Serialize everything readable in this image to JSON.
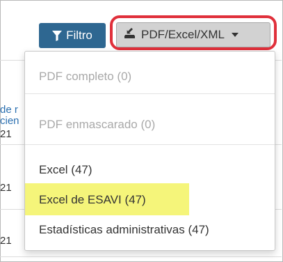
{
  "toolbar": {
    "filter_label": "Filtro",
    "export_label": "PDF/Excel/XML"
  },
  "export_menu": {
    "items": [
      {
        "label": "PDF completo (0)",
        "enabled": false
      },
      {
        "label": "PDF enmascarado (0)",
        "enabled": false
      },
      {
        "label": "Excel (47)",
        "enabled": true
      },
      {
        "label": "Excel de ESAVI (47)",
        "enabled": true,
        "highlighted": true
      },
      {
        "label": "Estadísticas administrativas (47)",
        "enabled": true
      }
    ]
  },
  "background_table": {
    "fragments": [
      "de r",
      "cien",
      "21",
      "21",
      "21"
    ]
  },
  "colors": {
    "filter_button": "#2e6791",
    "export_button": "#d2d2d2",
    "annotation_ring": "#e0303b",
    "highlight": "#f5f57a",
    "disabled_text": "#a9a9a9"
  },
  "icons": {
    "filter": "funnel-icon",
    "export": "download-tray-icon",
    "caret": "caret-down-icon"
  }
}
